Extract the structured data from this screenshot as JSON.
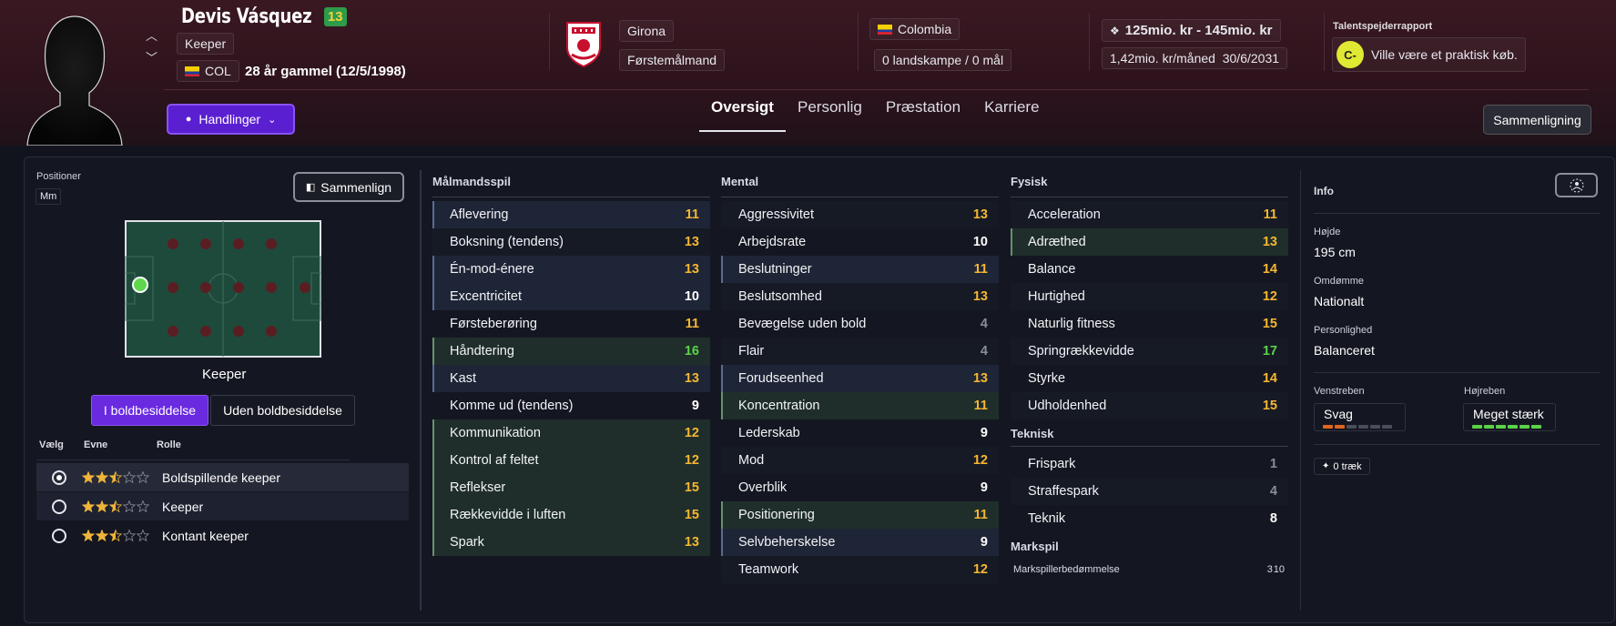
{
  "player": {
    "name": "Devis Vásquez",
    "rating_badge": "13",
    "position": "Keeper",
    "nation_code": "COL",
    "age_text": "28 år gammel (12/5/1998)"
  },
  "club": {
    "name": "Girona",
    "league": "Førstemålmand"
  },
  "nation": {
    "name": "Colombia",
    "caps": "0 landskampe / 0 mål"
  },
  "contract": {
    "value": "125mio. kr - 145mio. kr",
    "wage": "1,42mio. kr/måned",
    "expiry": "30/6/2031"
  },
  "scout": {
    "title": "Talentspejderrapport",
    "grade": "C-",
    "text": "Ville være et praktisk køb."
  },
  "actions_label": "Handlinger",
  "tabs": [
    "Oversigt",
    "Personlig",
    "Præstation",
    "Karriere"
  ],
  "compare_label": "Sammenligning",
  "left": {
    "positions_label": "Positioner",
    "positions_value": "Mm",
    "compare_label": "Sammenlign",
    "pitch_label": "Keeper",
    "poss_on": "I boldbesiddelse",
    "poss_off": "Uden boldbesiddelse",
    "role_headers": [
      "Vælg",
      "Evne",
      "Rolle"
    ],
    "roles": [
      {
        "name": "Boldspillende keeper",
        "stars": 2.5,
        "selected": true
      },
      {
        "name": "Keeper",
        "stars": 2.5,
        "selected": false
      },
      {
        "name": "Kontant keeper",
        "stars": 2.5,
        "selected": false
      }
    ]
  },
  "attributes": {
    "goalkeeping": {
      "title": "Målmandsspil",
      "rows": [
        {
          "name": "Aflevering",
          "value": "11",
          "tone": "blue",
          "color": "y"
        },
        {
          "name": "Boksning (tendens)",
          "value": "13",
          "tone": "plain",
          "color": "y"
        },
        {
          "name": "Én-mod-énere",
          "value": "13",
          "tone": "blue",
          "color": "y"
        },
        {
          "name": "Excentricitet",
          "value": "10",
          "tone": "blue",
          "color": "w"
        },
        {
          "name": "Førsteberøring",
          "value": "11",
          "tone": "none",
          "color": "y"
        },
        {
          "name": "Håndtering",
          "value": "16",
          "tone": "green",
          "color": "g"
        },
        {
          "name": "Kast",
          "value": "13",
          "tone": "blue",
          "color": "y"
        },
        {
          "name": "Komme ud (tendens)",
          "value": "9",
          "tone": "none",
          "color": "w"
        },
        {
          "name": "Kommunikation",
          "value": "12",
          "tone": "green",
          "color": "y"
        },
        {
          "name": "Kontrol af feltet",
          "value": "12",
          "tone": "green",
          "color": "y"
        },
        {
          "name": "Reflekser",
          "value": "15",
          "tone": "green",
          "color": "y"
        },
        {
          "name": "Rækkevidde i luften",
          "value": "15",
          "tone": "green",
          "color": "y"
        },
        {
          "name": "Spark",
          "value": "13",
          "tone": "green",
          "color": "y"
        }
      ]
    },
    "mental": {
      "title": "Mental",
      "rows": [
        {
          "name": "Aggressivitet",
          "value": "13",
          "tone": "plain",
          "color": "y"
        },
        {
          "name": "Arbejdsrate",
          "value": "10",
          "tone": "none",
          "color": "w"
        },
        {
          "name": "Beslutninger",
          "value": "11",
          "tone": "blue",
          "color": "y"
        },
        {
          "name": "Beslutsomhed",
          "value": "13",
          "tone": "plain",
          "color": "y"
        },
        {
          "name": "Bevægelse uden bold",
          "value": "4",
          "tone": "none",
          "color": "d"
        },
        {
          "name": "Flair",
          "value": "4",
          "tone": "plain",
          "color": "d"
        },
        {
          "name": "Forudseenhed",
          "value": "13",
          "tone": "blue",
          "color": "y"
        },
        {
          "name": "Koncentration",
          "value": "11",
          "tone": "green",
          "color": "y"
        },
        {
          "name": "Lederskab",
          "value": "9",
          "tone": "none",
          "color": "w"
        },
        {
          "name": "Mod",
          "value": "12",
          "tone": "plain",
          "color": "y"
        },
        {
          "name": "Overblik",
          "value": "9",
          "tone": "none",
          "color": "w"
        },
        {
          "name": "Positionering",
          "value": "11",
          "tone": "green",
          "color": "y"
        },
        {
          "name": "Selvbeherskelse",
          "value": "9",
          "tone": "blue",
          "color": "w"
        },
        {
          "name": "Teamwork",
          "value": "12",
          "tone": "plain",
          "color": "y"
        }
      ]
    },
    "physical": {
      "title": "Fysisk",
      "rows": [
        {
          "name": "Acceleration",
          "value": "11",
          "tone": "plain",
          "color": "y"
        },
        {
          "name": "Adræthed",
          "value": "13",
          "tone": "green",
          "color": "y"
        },
        {
          "name": "Balance",
          "value": "14",
          "tone": "none",
          "color": "y"
        },
        {
          "name": "Hurtighed",
          "value": "12",
          "tone": "plain",
          "color": "y"
        },
        {
          "name": "Naturlig fitness",
          "value": "15",
          "tone": "none",
          "color": "y"
        },
        {
          "name": "Springrækkevidde",
          "value": "17",
          "tone": "plain",
          "color": "g"
        },
        {
          "name": "Styrke",
          "value": "14",
          "tone": "none",
          "color": "y"
        },
        {
          "name": "Udholdenhed",
          "value": "15",
          "tone": "plain",
          "color": "y"
        }
      ]
    },
    "technical": {
      "title": "Teknisk",
      "rows": [
        {
          "name": "Frispark",
          "value": "1",
          "tone": "none",
          "color": "d"
        },
        {
          "name": "Straffespark",
          "value": "4",
          "tone": "plain",
          "color": "d"
        },
        {
          "name": "Teknik",
          "value": "8",
          "tone": "none",
          "color": "w"
        }
      ]
    },
    "fieldplay": {
      "title": "Markspil",
      "label": "Markspillerbedømmelse",
      "value": "3",
      "suffix": "10"
    }
  },
  "info": {
    "title": "Info",
    "height_label": "Højde",
    "height": "195 cm",
    "reputation_label": "Omdømme",
    "reputation": "Nationalt",
    "personality_label": "Personlighed",
    "personality": "Balanceret",
    "left_foot_label": "Venstreben",
    "left_foot": "Svag",
    "left_foot_level": 2,
    "right_foot_label": "Højreben",
    "right_foot": "Meget stærk",
    "right_foot_level": 6,
    "traits": "0 træk"
  },
  "colors": {
    "accent": "#5b1fd2",
    "yellow": "#f7b731",
    "green": "#5ad348",
    "header": "#3a1822"
  }
}
